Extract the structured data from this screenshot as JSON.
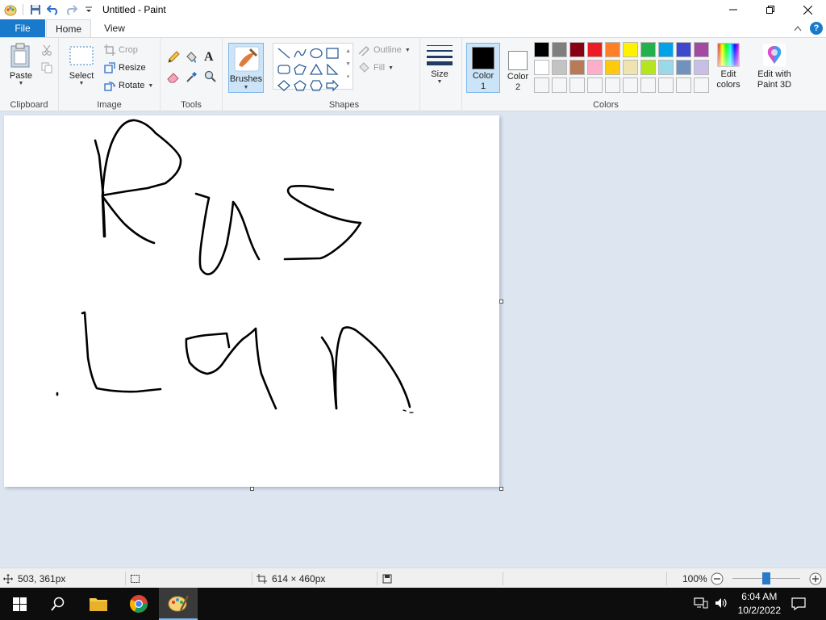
{
  "window": {
    "title": "Untitled - Paint"
  },
  "tabs": {
    "file": "File",
    "home": "Home",
    "view": "View"
  },
  "ribbon": {
    "clipboard": {
      "paste": "Paste",
      "group": "Clipboard"
    },
    "image": {
      "select": "Select",
      "crop": "Crop",
      "resize": "Resize",
      "rotate": "Rotate",
      "group": "Image"
    },
    "tools": {
      "group": "Tools"
    },
    "brushes": {
      "label": "Brushes"
    },
    "shapes": {
      "outline": "Outline",
      "fill": "Fill",
      "size": "Size",
      "group": "Shapes"
    },
    "colors": {
      "color1_line1": "Color",
      "color1_line2": "1",
      "color2_line1": "Color",
      "color2_line2": "2",
      "edit_line1": "Edit",
      "edit_line2": "colors",
      "paint3d_line1": "Edit with",
      "paint3d_line2": "Paint 3D",
      "group": "Colors",
      "color1_value": "#000000",
      "color2_value": "#ffffff",
      "palette": [
        "#000000",
        "#7f7f7f",
        "#880015",
        "#ed1c24",
        "#ff7f27",
        "#fff200",
        "#22b14c",
        "#00a2e8",
        "#3f48cc",
        "#a349a4",
        "#ffffff",
        "#c3c3c3",
        "#b97a57",
        "#ffaec9",
        "#ffc90e",
        "#efe4b0",
        "#b5e61d",
        "#99d9ea",
        "#7092be",
        "#c8bfe7",
        "#f5f6f7",
        "#f5f6f7",
        "#f5f6f7",
        "#f5f6f7",
        "#f5f6f7",
        "#f5f6f7",
        "#f5f6f7",
        "#f5f6f7",
        "#f5f6f7",
        "#f5f6f7"
      ]
    }
  },
  "statusbar": {
    "cursor_pos": "503, 361px",
    "canvas_size": "614 × 460px",
    "zoom": "100%",
    "zoom_level": 0.5
  },
  "taskbar": {
    "time": "6:04 AM",
    "date": "10/2/2022"
  }
}
